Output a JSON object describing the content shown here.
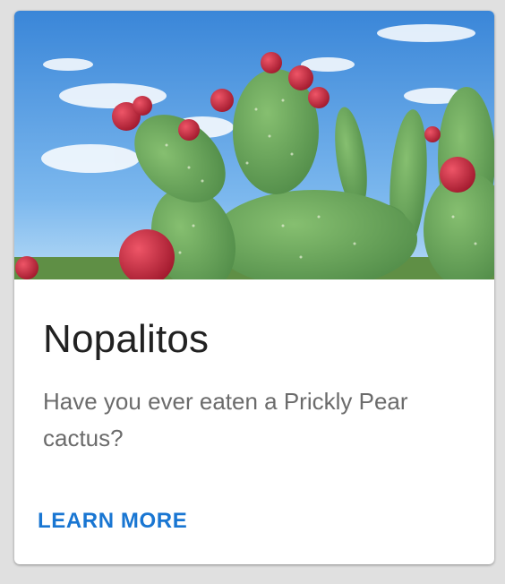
{
  "card": {
    "image": {
      "subject": "prickly-pear-cactus-photo",
      "colors": {
        "sky_top": "#3f8fdd",
        "sky_bottom": "#a9d3f5",
        "pad": "#6aa65a",
        "pad_dark": "#4e8b45",
        "fruit": "#c8283c"
      }
    },
    "title": "Nopalitos",
    "description": "Have you ever eaten a Prickly Pear cactus?",
    "action_label": "LEARN MORE",
    "accent_color": "#1976d2"
  }
}
